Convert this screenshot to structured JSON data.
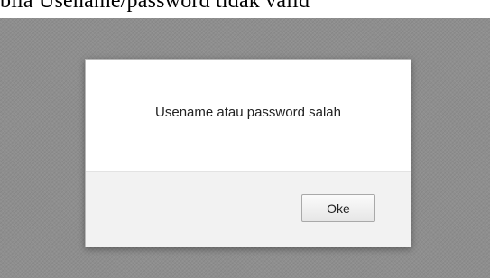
{
  "caption": {
    "text": "bila Usename/password tidak valid"
  },
  "dialog": {
    "message": "Usename atau password salah",
    "ok_label": "Oke"
  }
}
